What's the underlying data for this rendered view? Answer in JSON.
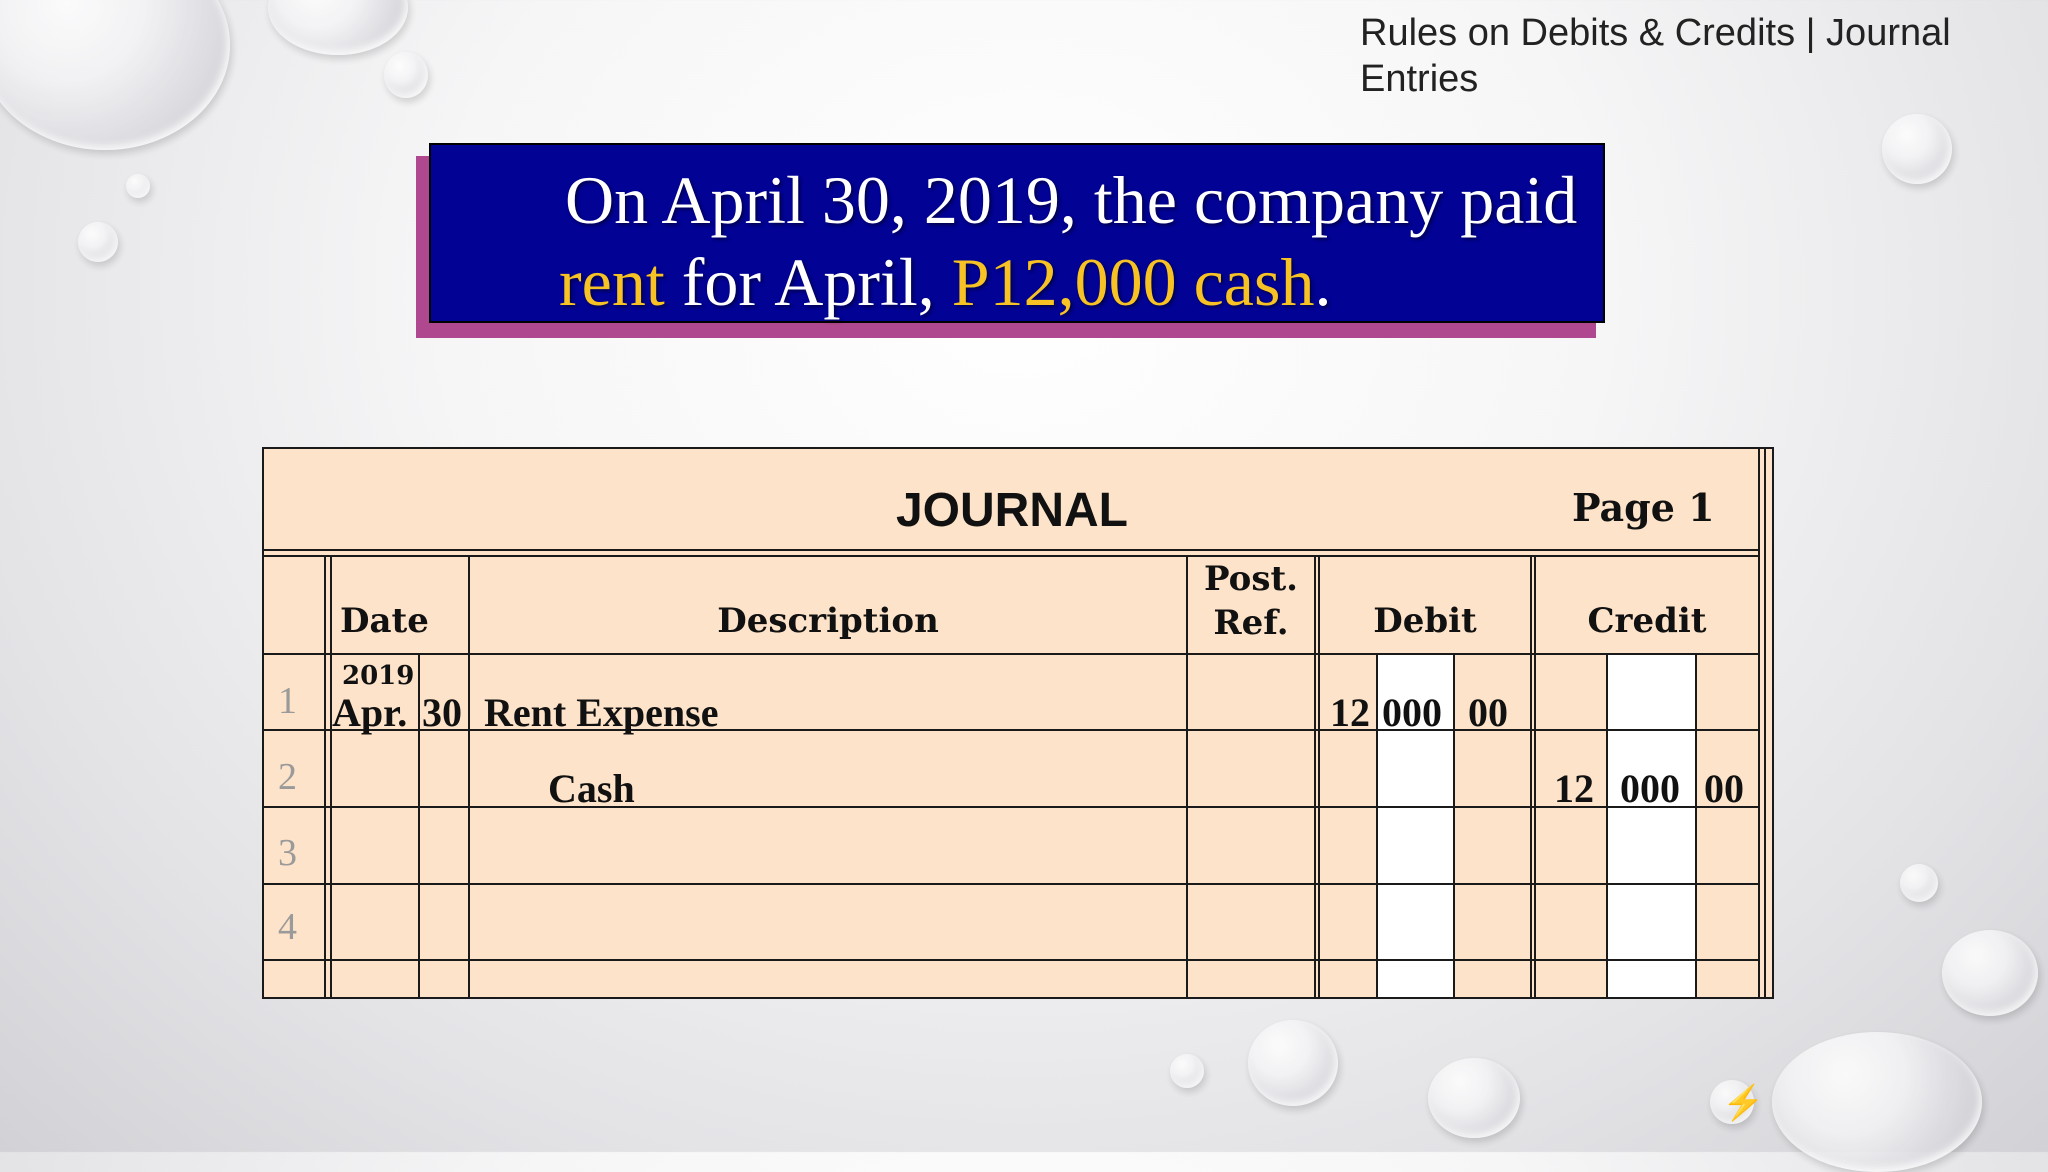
{
  "slide": {
    "header_title": "Rules on Debits & Credits | Journal Entries",
    "callout": {
      "line1": "On April 30, 2019, the company paid",
      "line2_part1": "rent",
      "line2_part2": " for April, ",
      "line2_part3": "P12,000 cash",
      "line2_part4": "."
    }
  },
  "journal": {
    "title": "JOURNAL",
    "page_label": "Page",
    "page_number": "1",
    "headers": {
      "date": "Date",
      "description": "Description",
      "post_ref_line1": "Post.",
      "post_ref_line2": "Ref.",
      "debit": "Debit",
      "credit": "Credit"
    },
    "line_numbers": [
      "1",
      "2",
      "3",
      "4"
    ],
    "rows": [
      {
        "year": "2019",
        "month": "Apr.",
        "day": "30",
        "description": "Rent Expense",
        "debit_thousands": "12",
        "debit_hundreds": "000",
        "debit_cents": "00",
        "credit_thousands": "",
        "credit_hundreds": "",
        "credit_cents": ""
      },
      {
        "year": "",
        "month": "",
        "day": "",
        "description": "Cash",
        "debit_thousands": "",
        "debit_hundreds": "",
        "debit_cents": "",
        "credit_thousands": "12",
        "credit_hundreds": "000",
        "credit_cents": "00"
      }
    ]
  },
  "colors": {
    "callout_bg": "#020295",
    "callout_shadow": "#b0488f",
    "highlight": "#f6c224",
    "journal_bg": "#fde3c9"
  }
}
